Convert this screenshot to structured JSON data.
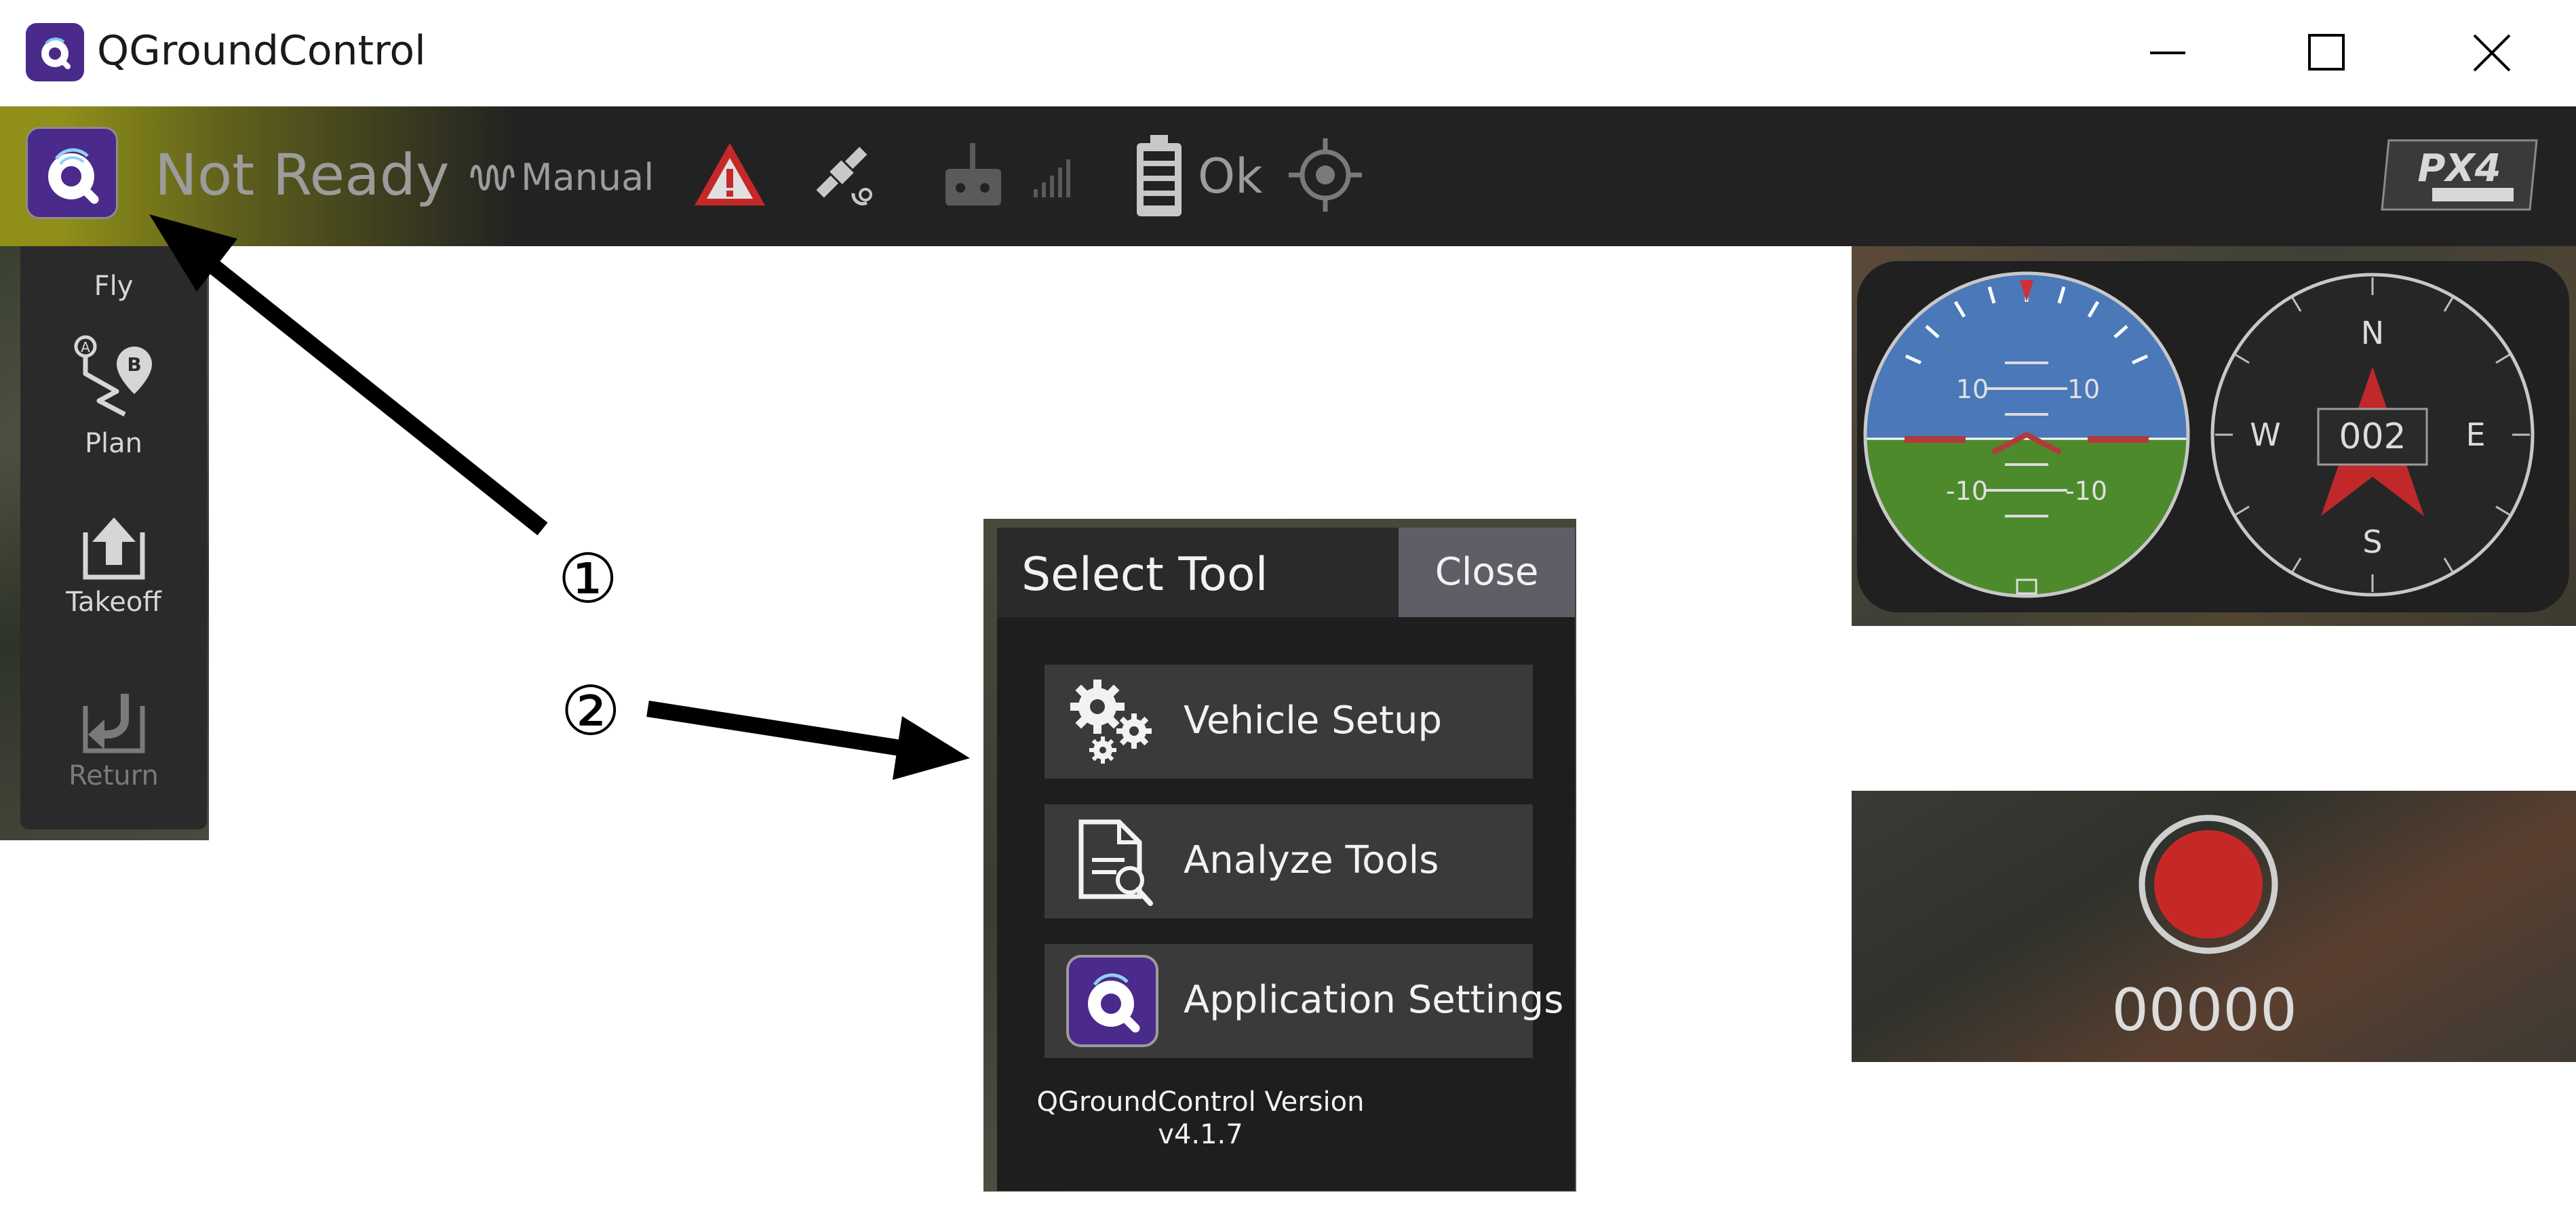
{
  "window": {
    "title": "QGroundControl"
  },
  "toolbar": {
    "status": "Not Ready",
    "flight_mode": "Manual",
    "battery_status": "Ok",
    "brand_logo": "PX4"
  },
  "fly_panel": {
    "items": [
      {
        "label": "Fly",
        "icon": "fly-icon"
      },
      {
        "label": "Plan",
        "icon": "plan-path-icon"
      },
      {
        "label": "Takeoff",
        "icon": "takeoff-icon"
      },
      {
        "label": "Return",
        "icon": "return-icon"
      }
    ]
  },
  "annotations": {
    "label_1": "①",
    "label_2": "②"
  },
  "select_tool_dialog": {
    "title": "Select Tool",
    "close_label": "Close",
    "tools": [
      {
        "label": "Vehicle Setup",
        "icon": "gears-icon"
      },
      {
        "label": "Analyze Tools",
        "icon": "analyze-document-icon"
      },
      {
        "label": "Application Settings",
        "icon": "qgc-logo-icon"
      }
    ],
    "version_line1": "QGroundControl Version",
    "version_line2": "v4.1.7"
  },
  "instruments": {
    "attitude_ticks": [
      "10",
      "10",
      "-10",
      "-10"
    ],
    "heading": "002",
    "compass_labels": [
      "N",
      "E",
      "S",
      "W"
    ]
  },
  "video": {
    "record_time": "00000"
  },
  "colors": {
    "toolbar_bg": "#222222",
    "status_gradient": "#8f8f1a",
    "qgc_purple": "#4a2a8a",
    "record_red": "#c62828",
    "sky_blue": "#4a78b8",
    "ground_green": "#4d8a2c"
  }
}
